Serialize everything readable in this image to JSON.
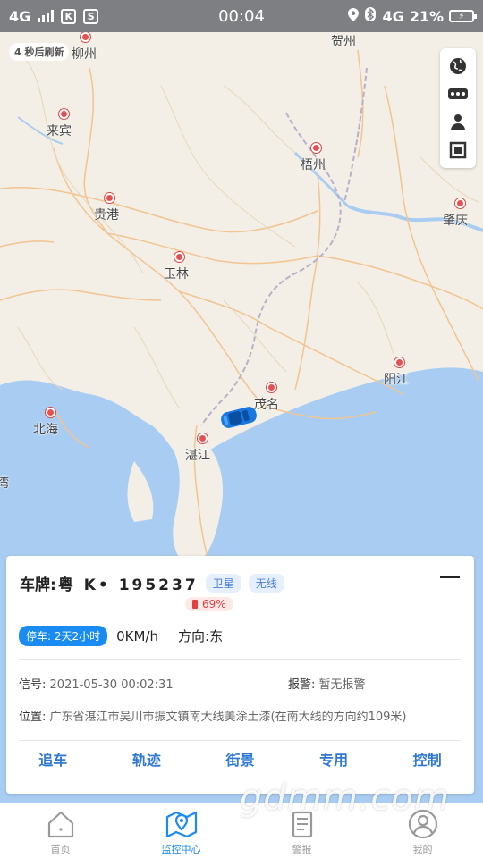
{
  "status_bar": {
    "network": "4G",
    "time": "00:04",
    "mobile_data": "4G",
    "battery_pct": "21%",
    "k_icon": "K",
    "s_icon": "S"
  },
  "map": {
    "refresh_text": "4 秒后刷新",
    "cities": [
      {
        "name": "柳州"
      },
      {
        "name": "贺州"
      },
      {
        "name": "来宾"
      },
      {
        "name": "梧州"
      },
      {
        "name": "贵港"
      },
      {
        "name": "肇庆"
      },
      {
        "name": "玉林"
      },
      {
        "name": "阳江"
      },
      {
        "name": "茂名"
      },
      {
        "name": "北海"
      },
      {
        "name": "湛江"
      },
      {
        "name": "湾"
      }
    ],
    "tools": [
      "globe-icon",
      "traffic-icon",
      "person-icon",
      "frame-icon"
    ]
  },
  "vehicle": {
    "plate_label": "车牌:",
    "plate_value": "粤 K• 195237",
    "tag_satellite": "卫星",
    "tag_wireless": "无线",
    "battery": "69%",
    "parking": "停车: 2天2小时",
    "speed": "0KM/h",
    "direction_label": "方向:",
    "direction_value": "东",
    "signal_label": "信号:",
    "signal_value": "2021-05-30 00:02:31",
    "alarm_label": "报警:",
    "alarm_value": "暂无报警",
    "location_label": "位置:",
    "location_value": "广东省湛江市吴川市振文镇南大线美涂土漆(在南大线的方向约109米)"
  },
  "actions": {
    "chase": "追车",
    "track": "轨迹",
    "street": "街景",
    "special": "专用",
    "control": "控制"
  },
  "tabs": {
    "home": "首页",
    "monitor": "监控中心",
    "alarm": "警报",
    "mine": "我的"
  },
  "watermark": "gdmm.com",
  "colors": {
    "accent": "#1a8bf0",
    "action_text": "#2f79d4",
    "sea": "#a9cdf2",
    "land": "#f3efe6",
    "city_marker": "#e45151"
  }
}
